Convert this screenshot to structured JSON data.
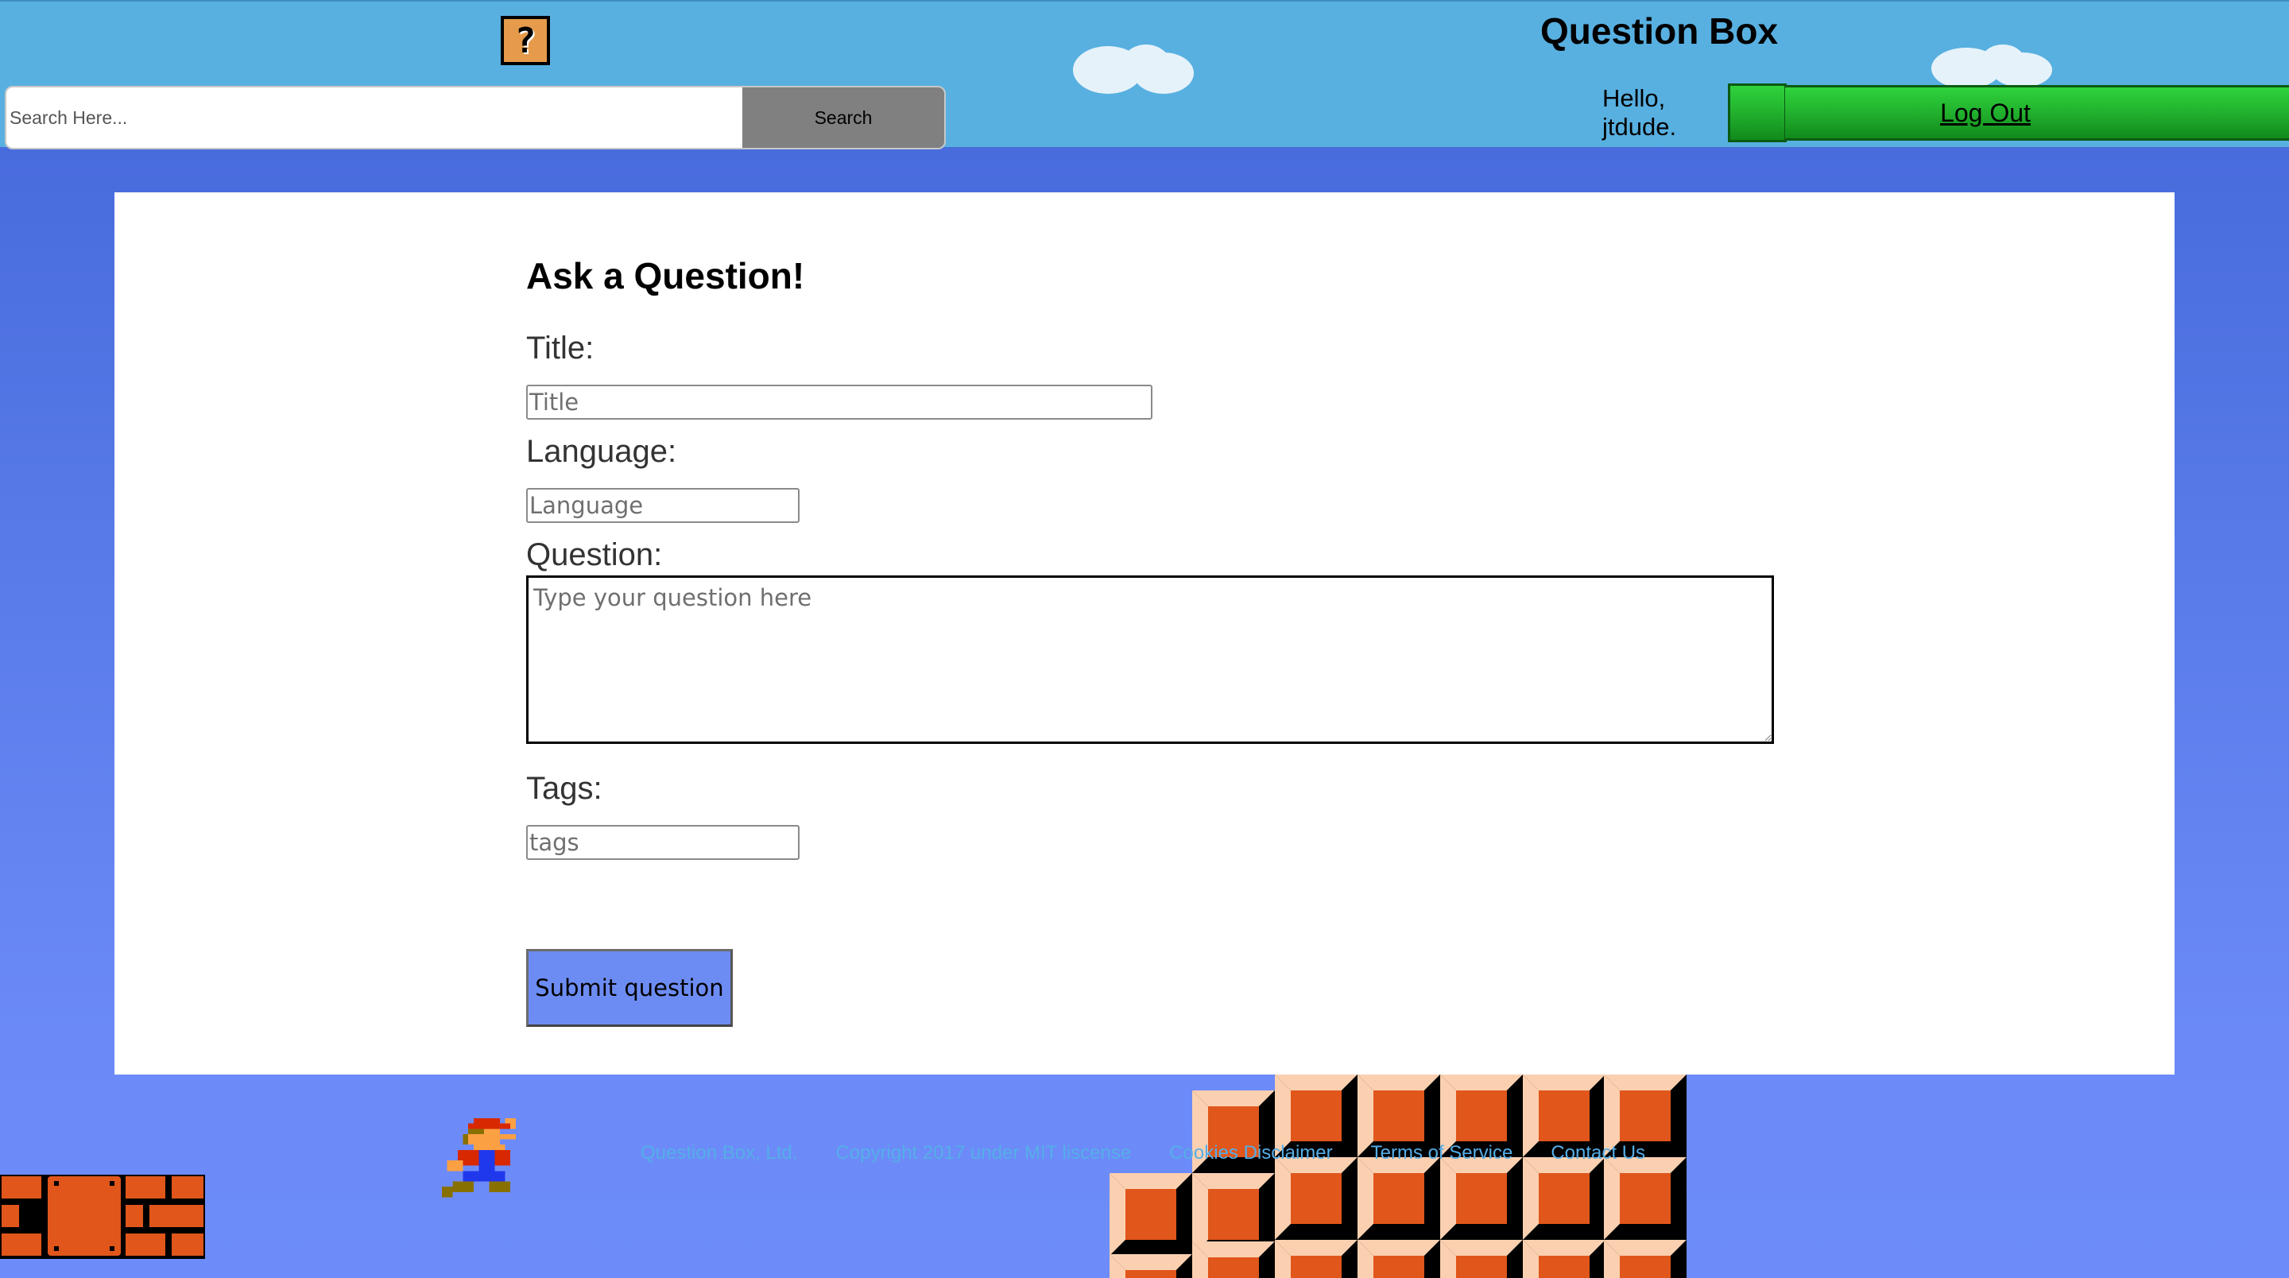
{
  "header": {
    "logo_icon": "question-block-icon",
    "logo_glyph": "?",
    "title": "Question Box",
    "search": {
      "placeholder": "Search Here...",
      "button_label": "Search"
    },
    "greeting_line1": "Hello,",
    "greeting_line2": "jtdude.",
    "logout_label": "Log Out"
  },
  "form": {
    "heading": "Ask a Question!",
    "title_label": "Title:",
    "title_placeholder": "Title",
    "language_label": "Language:",
    "language_placeholder": "Language",
    "question_label": "Question:",
    "question_placeholder": "Type your question here",
    "tags_label": "Tags:",
    "tags_placeholder": "tags",
    "submit_label": "Submit question"
  },
  "footer": {
    "links": [
      "Question Box, Ltd.",
      "Copyright 2017 under MIT liscense",
      "Cookies Disclaimer",
      "Terms of Service",
      "Contact Us"
    ]
  },
  "colors": {
    "header_sky": "#58b0e0",
    "page_sky": "#4366d9",
    "pipe_green": "#23b42f",
    "submit_blue": "#6d8cf3",
    "footer_link": "#55aee8",
    "block_orange": "#e59b4b"
  }
}
